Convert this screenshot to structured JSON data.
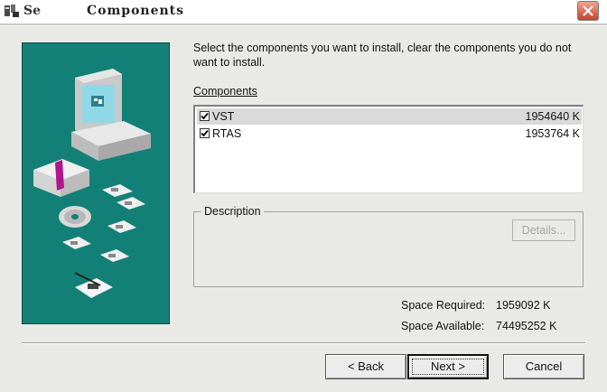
{
  "window": {
    "title_prefix": "Se",
    "title": "Components"
  },
  "content": {
    "instructions": "Select the components you want to install, clear the components you do not want to install.",
    "components_label": "Components",
    "components": [
      {
        "name": "VST",
        "size": "1954640 K",
        "checked": true
      },
      {
        "name": "RTAS",
        "size": "1953764 K",
        "checked": true
      }
    ],
    "description_label": "Description",
    "details_button": "Details...",
    "space_required_label": "Space Required:",
    "space_required_value": "1959092 K",
    "space_available_label": "Space Available:",
    "space_available_value": "74495252 K"
  },
  "buttons": {
    "back": "< Back",
    "next": "Next >",
    "cancel": "Cancel"
  },
  "icons": {
    "app": "installer-app-icon",
    "close": "close-icon",
    "illustration": "setup-computer-illustration"
  },
  "colors": {
    "panel": "#138077",
    "close": "#c2452e"
  }
}
